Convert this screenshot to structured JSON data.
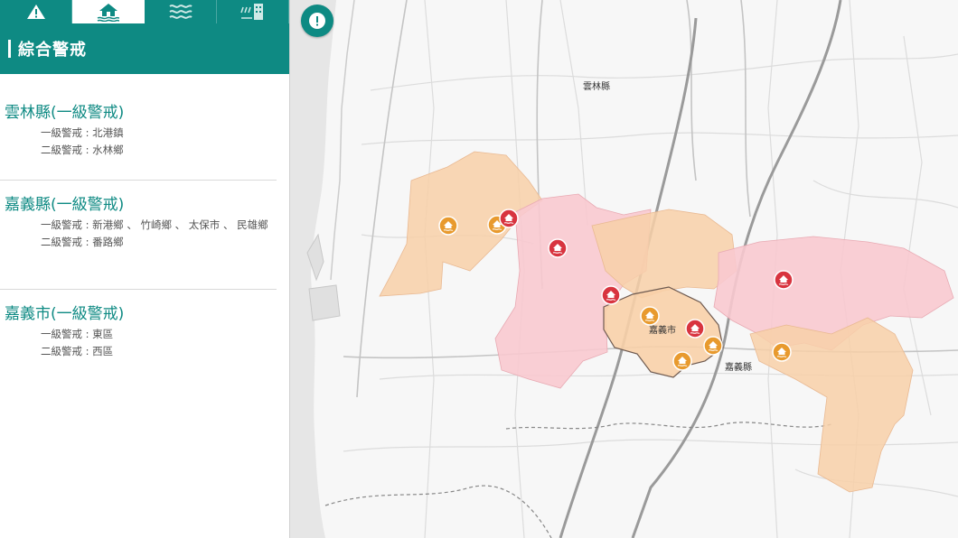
{
  "panel": {
    "tabs": [
      {
        "icon": "warning-icon"
      },
      {
        "icon": "flood-house-icon"
      },
      {
        "icon": "waves-icon"
      },
      {
        "icon": "rain-building-icon"
      }
    ],
    "header_title": "綜合警戒",
    "counties": [
      {
        "name": "雲林縣(一級警戒)",
        "lines": [
          "一級警戒 : 北港鎮",
          "二級警戒 : 水林鄉"
        ]
      },
      {
        "name": "嘉義縣(一級警戒)",
        "lines": [
          "一級警戒 : 新港鄉 、 竹崎鄉 、 太保市 、 民雄鄉",
          "二級警戒 : 番路鄉"
        ]
      },
      {
        "name": "嘉義市(一級警戒)",
        "lines": [
          "一級警戒 : 東區",
          "二級警戒 : 西區"
        ]
      }
    ]
  },
  "map": {
    "labels": {
      "yunlin": "雲林縣",
      "chiayi_city": "嘉義市",
      "chiayi_county": "嘉義縣"
    },
    "colors": {
      "level1_fill": "#f8c9cf",
      "level2_fill": "#f8d0a8",
      "level1_marker": "#d8343f",
      "level2_marker": "#e89a2e",
      "accent": "#0e8a83"
    },
    "overlay_button_icon": "warning-icon"
  }
}
